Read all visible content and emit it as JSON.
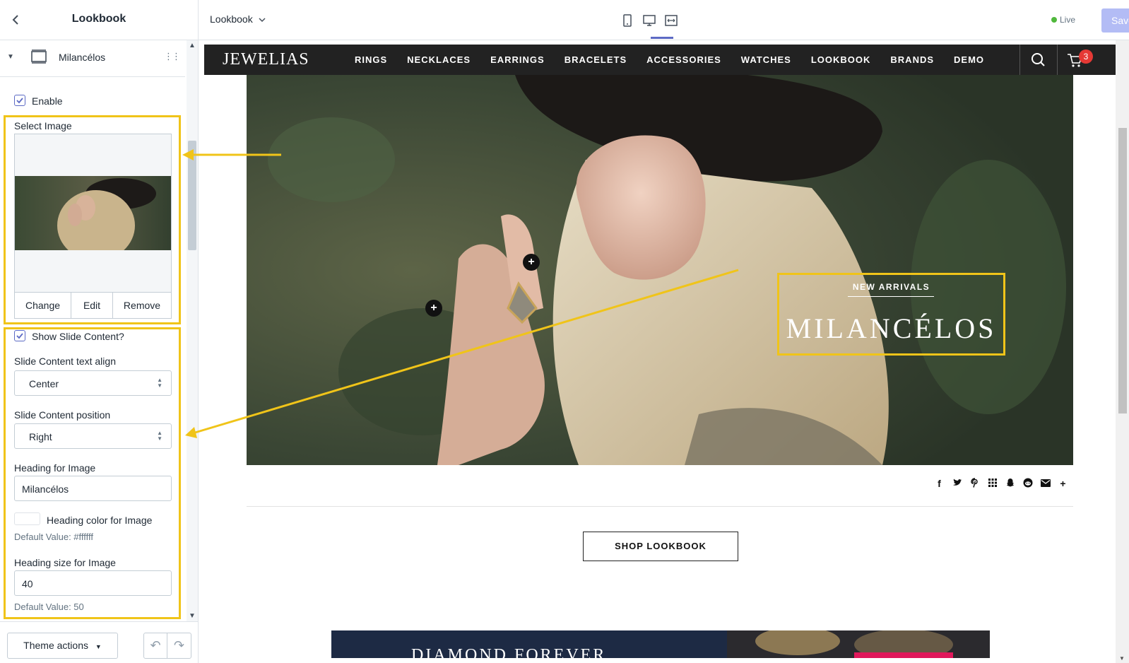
{
  "sidebar": {
    "title": "Lookbook",
    "section_label": "Milancélos",
    "enable_label": "Enable",
    "enable_checked": true,
    "select_image_label": "Select Image",
    "image_actions": [
      "Change",
      "Edit",
      "Remove"
    ],
    "show_content_label": "Show Slide Content?",
    "show_content_checked": true,
    "align_label": "Slide Content text align",
    "align_value": "Center",
    "position_label": "Slide Content position",
    "position_value": "Right",
    "heading_label": "Heading for Image",
    "heading_value": "Milancélos",
    "heading_color_label": "Heading color for Image",
    "heading_color_default": "Default Value: #ffffff",
    "heading_color": "#ffffff",
    "heading_size_label": "Heading size for Image",
    "heading_size_value": "40",
    "heading_size_default": "Default Value: 50",
    "theme_actions_label": "Theme actions"
  },
  "topbar": {
    "page_select": "Lookbook",
    "devices": [
      "mobile-icon",
      "desktop-icon",
      "full-width-icon"
    ],
    "active_device": "desktop-icon",
    "status": "Live",
    "save_label": "Save"
  },
  "store": {
    "logo": "JEWELIAS",
    "nav": [
      "RINGS",
      "NECKLACES",
      "EARRINGS",
      "BRACELETS",
      "ACCESSORIES",
      "WATCHES",
      "LOOKBOOK",
      "BRANDS",
      "DEMO"
    ],
    "cart_count": "3",
    "hero": {
      "subheading": "NEW ARRIVALS",
      "heading": "MILANCÉLOS"
    },
    "share_icons": [
      "facebook-icon",
      "twitter-icon",
      "pinterest-icon",
      "tumblr-icon",
      "snapchat-icon",
      "reddit-icon",
      "email-icon",
      "plus-icon"
    ],
    "shop_button": "SHOP LOOKBOOK",
    "banner_text": "DIAMOND FOREVER"
  },
  "colors": {
    "highlight": "#f0c419",
    "accent": "#5c6ac4",
    "nav_bg": "#222222",
    "badge": "#e53935"
  }
}
